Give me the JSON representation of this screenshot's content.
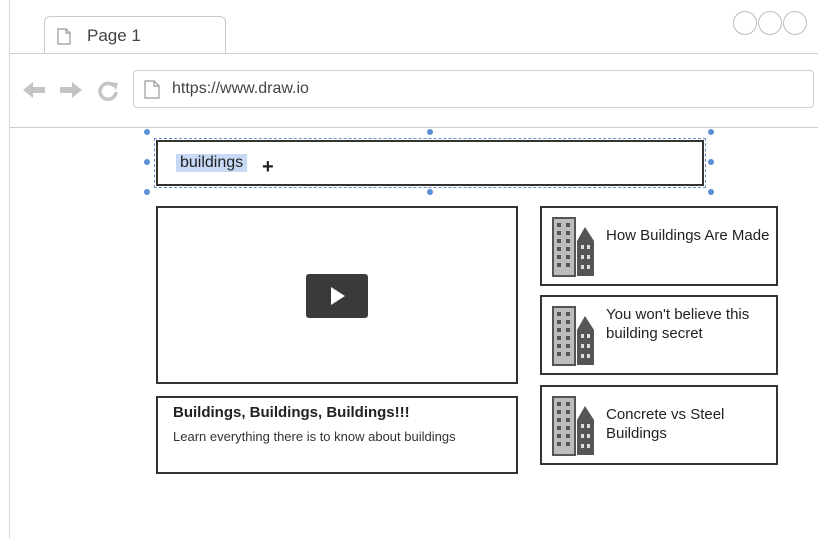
{
  "browser": {
    "tab_label": "Page 1",
    "url": "https://www.draw.io"
  },
  "search": {
    "value": "buildings"
  },
  "video": {
    "title": "Buildings, Buildings, Buildings!!!",
    "description": "Learn everything there is to know about buildings"
  },
  "related": [
    {
      "title": "How Buildings Are Made"
    },
    {
      "title": "You won't believe this building secret"
    },
    {
      "title": "Concrete vs Steel Buildings"
    }
  ],
  "icons": {
    "tab": "page-icon",
    "back": "back-arrow-icon",
    "forward": "forward-arrow-icon",
    "reload": "reload-icon",
    "url": "page-icon",
    "play": "play-icon",
    "card": "building-icon",
    "cursor": "crosshair-cursor-icon"
  },
  "colors": {
    "selection": "#c7d9f5",
    "handle": "#5b8fd6",
    "border": "#333333",
    "play_button": "#3a3a3a"
  }
}
